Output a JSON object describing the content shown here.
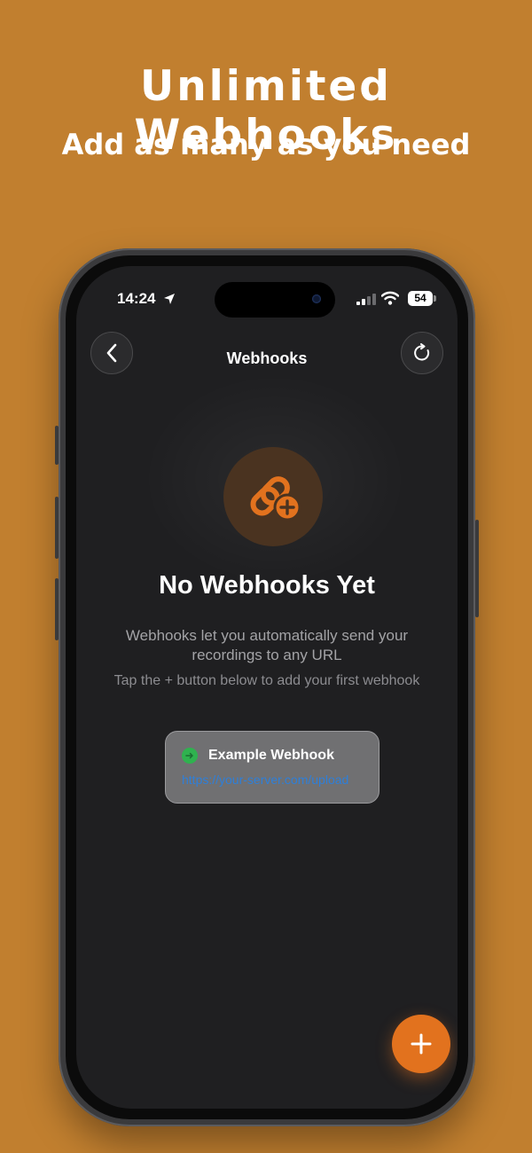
{
  "marketing": {
    "headline": "Unlimited Webhooks",
    "subheadline": "Add as many as you need"
  },
  "status_bar": {
    "time": "14:24",
    "battery": "54"
  },
  "nav": {
    "title": "Webhooks",
    "back_icon": "chevron-left-icon",
    "refresh_icon": "refresh-icon"
  },
  "empty_state": {
    "icon": "link-add-icon",
    "title": "No Webhooks Yet",
    "description": "Webhooks let you automatically send your recordings to any URL",
    "hint": "Tap the + button below to add your first webhook"
  },
  "example_card": {
    "title": "Example Webhook",
    "url": "https://your-server.com/upload"
  },
  "fab": {
    "icon": "plus-icon"
  },
  "colors": {
    "background": "#c17f2f",
    "accent": "#e2721e",
    "screen": "#1f1f21",
    "status_green": "#2fb24f",
    "link_blue": "#2e7fd9"
  }
}
